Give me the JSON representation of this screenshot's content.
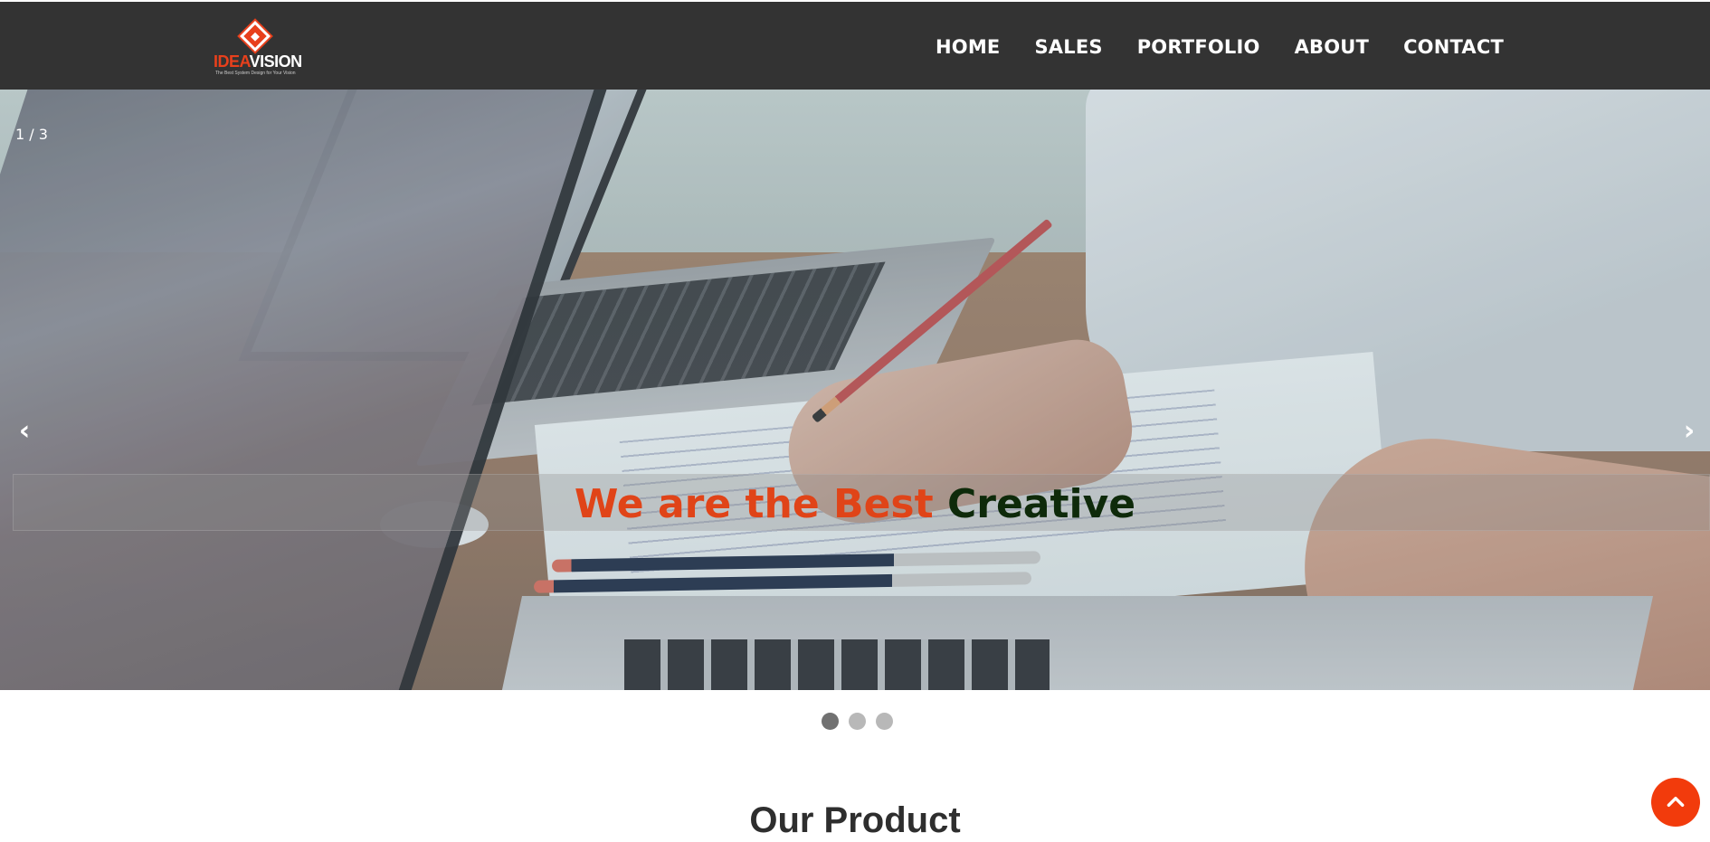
{
  "brand": {
    "logo_part1": "IDEA",
    "logo_part2": "VISION",
    "tagline": "The Best System Design for Your Vision",
    "accent_color": "#e8401c"
  },
  "nav": {
    "items": [
      {
        "label": "HOME"
      },
      {
        "label": "SALES"
      },
      {
        "label": "PORTFOLIO"
      },
      {
        "label": "ABOUT"
      },
      {
        "label": "CONTACT"
      }
    ]
  },
  "slider": {
    "counter": "1 / 3",
    "prev_icon": "‹",
    "next_icon": "›",
    "caption_part1": "We are the Best",
    "caption_part2": "Creative",
    "caption_color1": "#e04418",
    "caption_color2": "#0e2a0a",
    "slide_count": 3,
    "active_slide": 1
  },
  "section": {
    "title": "Our Product"
  },
  "back_to_top": {
    "icon": "chevron-up-icon",
    "color": "#f23b0c"
  }
}
